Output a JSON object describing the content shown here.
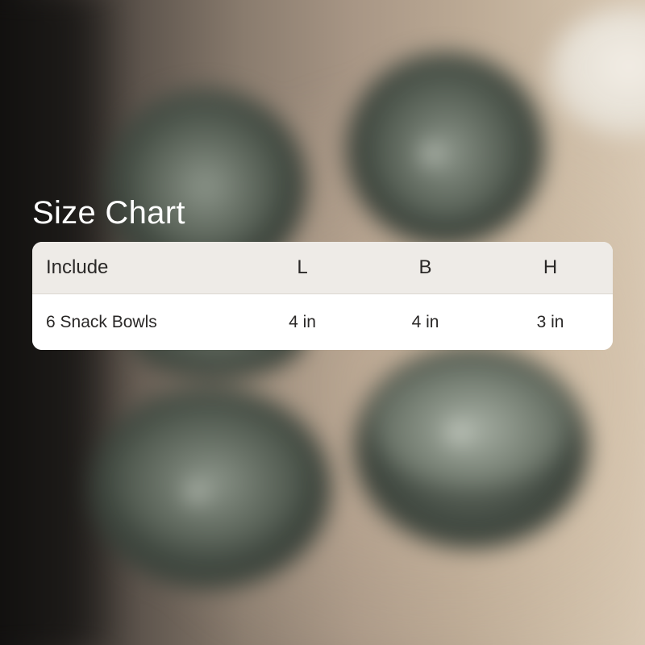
{
  "title": "Size Chart",
  "table": {
    "headers": [
      "Include",
      "L",
      "B",
      "H"
    ],
    "rows": [
      [
        "6 Snack Bowls",
        "4 in",
        "4 in",
        "3 in"
      ]
    ]
  },
  "background": {
    "subject": "six dark green ceramic snack bowls on a wooden table",
    "colors": {
      "bowl": "#4c544b",
      "table": "#b9a690",
      "left_shadow": "#121110"
    }
  },
  "colors": {
    "title_text": "#ffffff",
    "header_bg": "#eeebe7",
    "body_bg": "#ffffff",
    "text": "#2a2827"
  }
}
